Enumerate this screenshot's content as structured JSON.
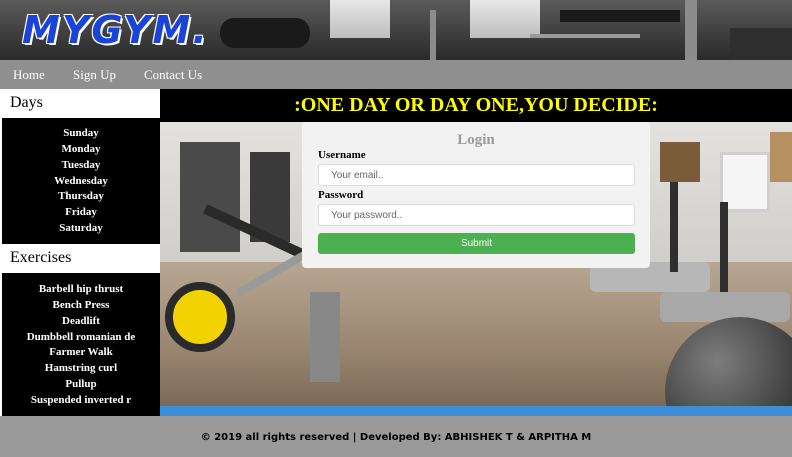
{
  "brand": {
    "logo_text": "MYGYM."
  },
  "nav": {
    "items": [
      "Home",
      "Sign Up",
      "Contact Us"
    ]
  },
  "sidebar": {
    "days_heading": "Days",
    "days": [
      "Sunday",
      "Monday",
      "Tuesday",
      "Wednesday",
      "Thursday",
      "Friday",
      "Saturday"
    ],
    "exercises_heading": "Exercises",
    "exercises": [
      "Barbell hip thrust",
      "Bench Press",
      "Deadlift",
      "Dumbbell romanian de",
      "Farmer Walk",
      "Hamstring curl",
      "Pullup",
      "Suspended inverted r"
    ]
  },
  "main": {
    "motto": ":ONE DAY OR DAY ONE,YOU DECIDE:"
  },
  "login": {
    "title": "Login",
    "username_label": "Username",
    "username_placeholder": "Your email..",
    "password_label": "Password",
    "password_placeholder": "Your password..",
    "submit_label": "Submit"
  },
  "footer": {
    "text": "© 2019 all rights reserved | Developed By: ABHISHEK T & ARPITHA M"
  },
  "colors": {
    "logo": "#1a44d8",
    "nav_bg": "#8f8f8f",
    "motto": "#ffff00",
    "submit": "#4caf50",
    "accent_strip": "#3d8ed6",
    "footer_bg": "#9a9a9a"
  }
}
